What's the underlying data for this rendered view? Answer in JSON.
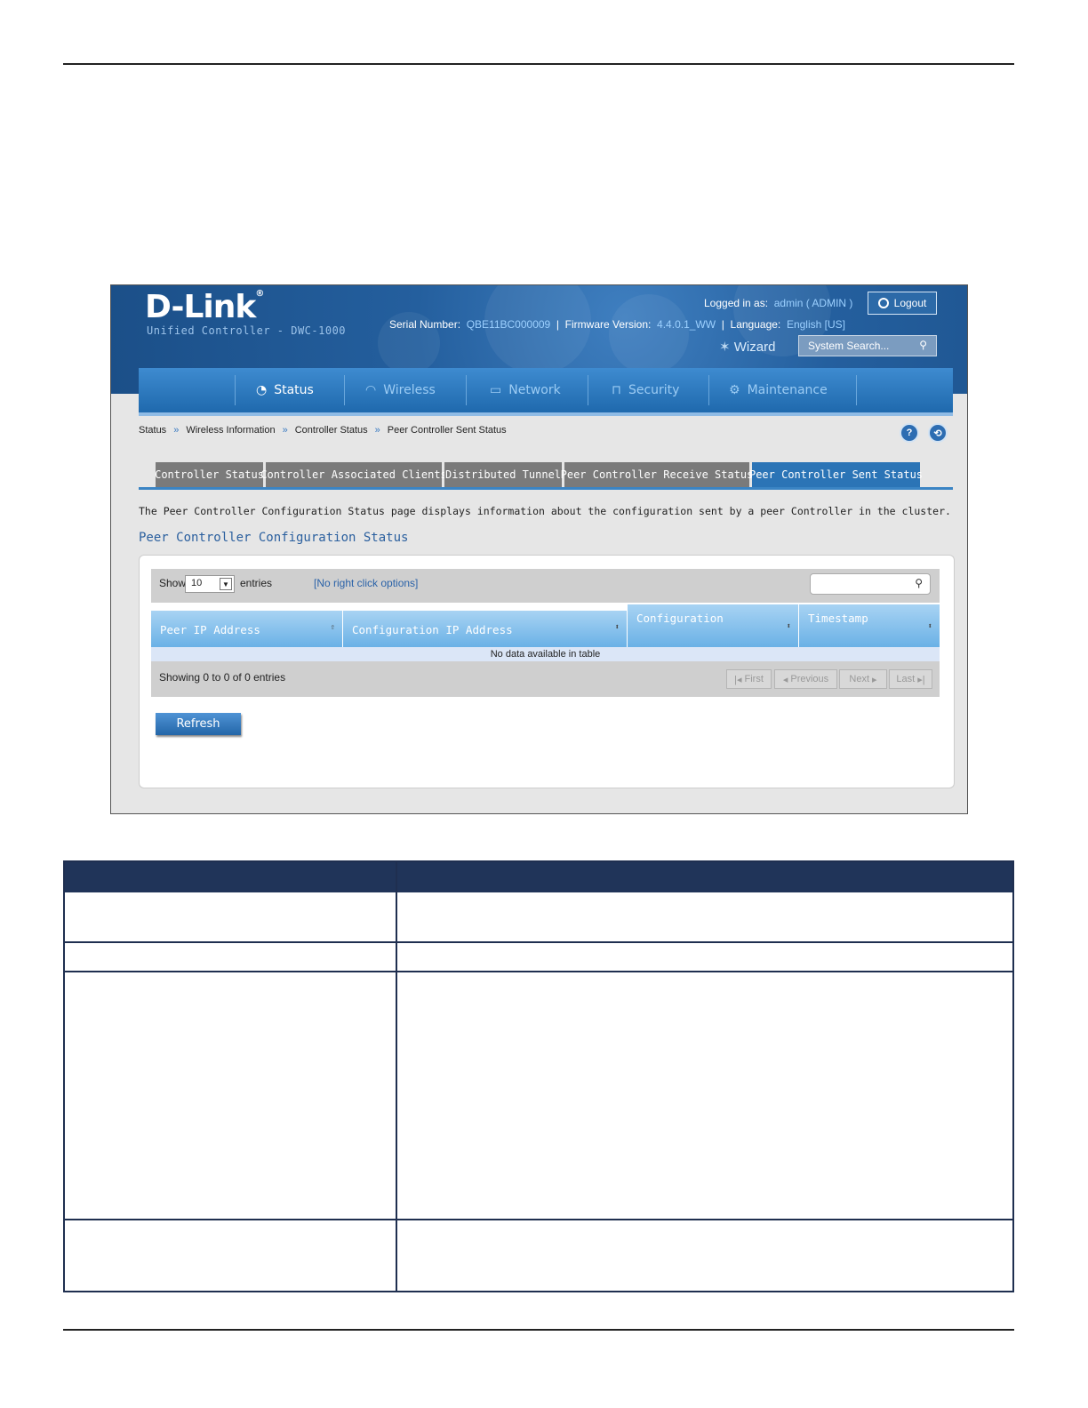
{
  "header": {
    "logo_text": "D-Link",
    "logo_reg": "®",
    "subtitle": "Unified Controller - DWC-1000",
    "logged_in_label": "Logged in as:",
    "logged_in_user": "admin ( ADMIN )",
    "logout_label": "Logout",
    "serial_label": "Serial Number:",
    "serial_value": "QBE11BC000009",
    "firmware_label": "Firmware Version:",
    "firmware_value": "4.4.0.1_WW",
    "language_label": "Language:",
    "language_value": "English [US]",
    "wizard_label": "Wizard",
    "search_placeholder": "System Search..."
  },
  "nav": {
    "items": [
      {
        "label": "Status",
        "icon": "gauge-icon",
        "active": true
      },
      {
        "label": "Wireless",
        "icon": "wifi-icon",
        "active": false
      },
      {
        "label": "Network",
        "icon": "monitor-icon",
        "active": false
      },
      {
        "label": "Security",
        "icon": "lock-icon",
        "active": false
      },
      {
        "label": "Maintenance",
        "icon": "gears-icon",
        "active": false
      }
    ]
  },
  "breadcrumb": [
    "Status",
    "Wireless Information",
    "Controller Status",
    "Peer Controller Sent Status"
  ],
  "breadcrumb_sep": "»",
  "help_buttons": [
    "?",
    "⟲"
  ],
  "tabs": [
    {
      "label": "Controller Status",
      "active": false
    },
    {
      "label": "Controller Associated Clients",
      "active": false
    },
    {
      "label": "Distributed Tunnel",
      "active": false
    },
    {
      "label": "Peer Controller Receive Status",
      "active": false
    },
    {
      "label": "Peer Controller Sent Status",
      "active": true
    }
  ],
  "description": "The Peer Controller Configuration Status page displays information about the configuration sent by a peer Controller in the cluster.",
  "section_title": "Peer Controller Configuration Status",
  "table": {
    "show_label": "Show",
    "show_value": "10",
    "entries_label": "entries",
    "no_right_click": "[No right click options]",
    "columns": [
      "Peer IP Address",
      "Configuration IP Address",
      "Configuration",
      "Timestamp"
    ],
    "empty_message": "No data available in table",
    "showing_text": "Showing 0 to 0 of 0 entries",
    "pager": [
      "First",
      "Previous",
      "Next",
      "Last"
    ]
  },
  "refresh_label": "Refresh",
  "colors": {
    "accent": "#2b74b6",
    "header_dark": "#1b4f88",
    "table_header": "#203459"
  }
}
